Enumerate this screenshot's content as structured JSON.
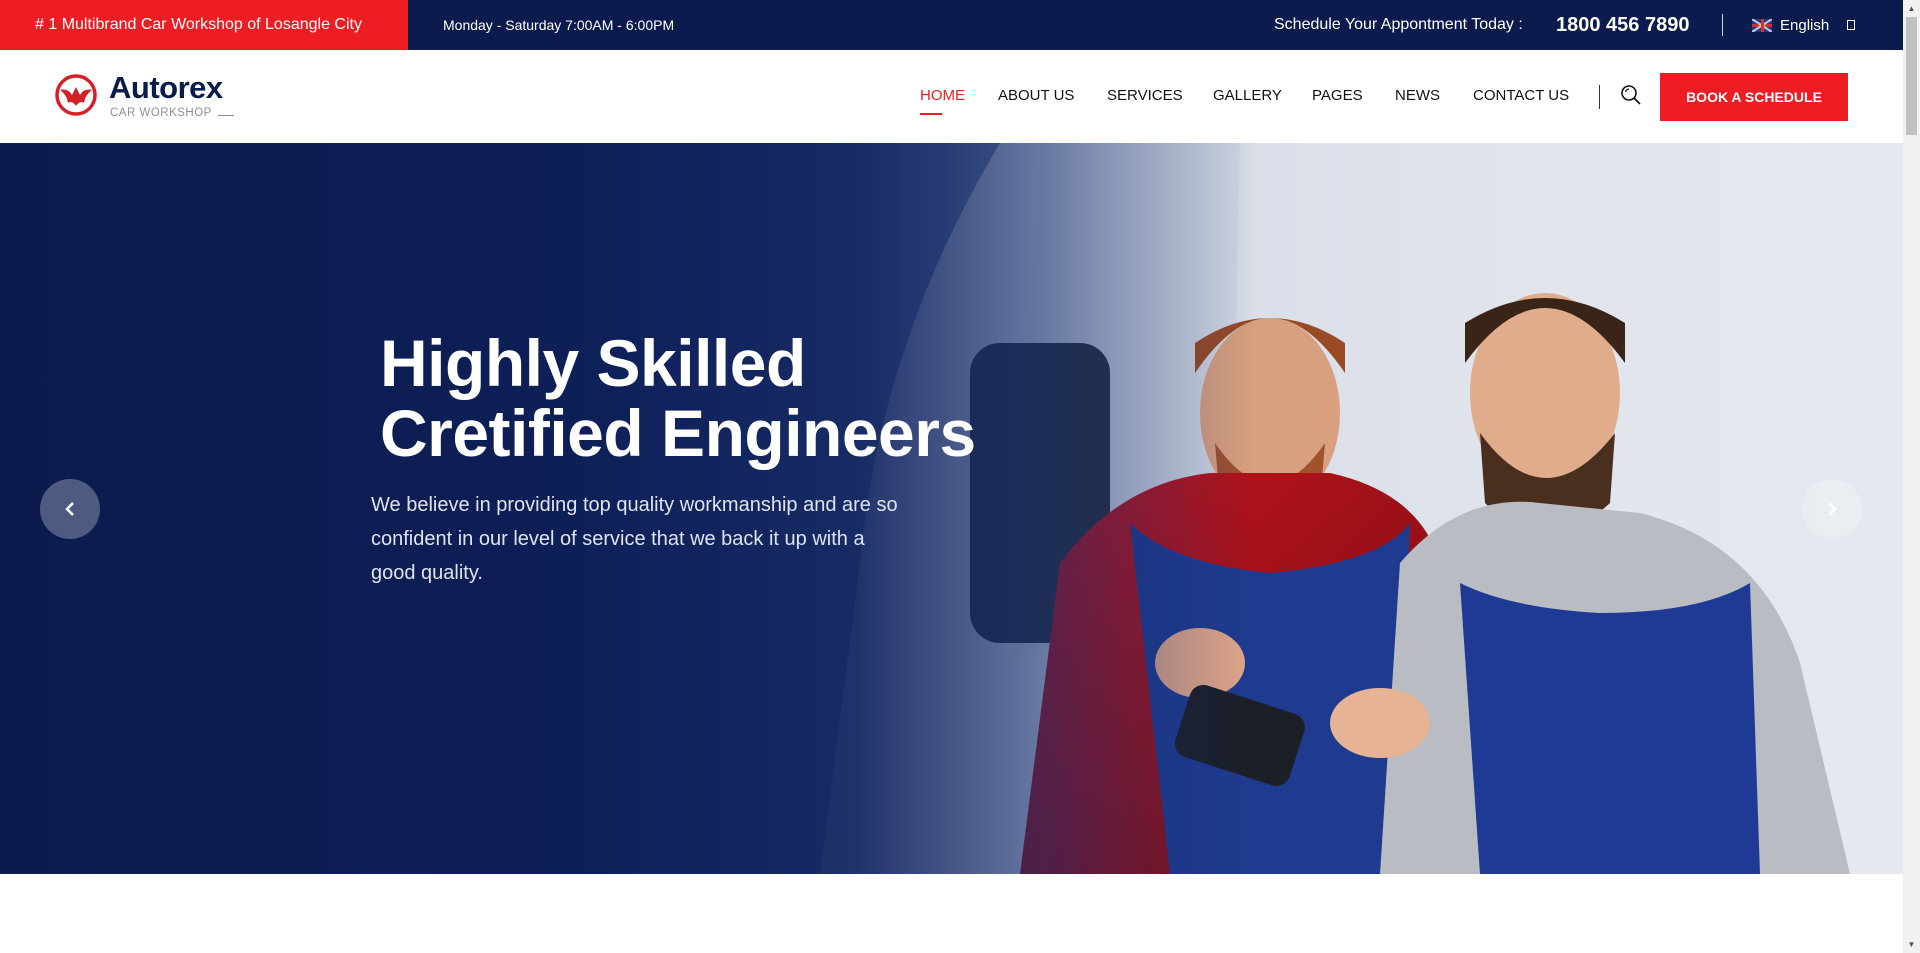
{
  "topbar": {
    "tagline": "# 1 Multibrand Car Workshop of Losangle City",
    "hours": "Monday - Saturday 7:00AM - 6:00PM",
    "schedule_label": "Schedule Your Appontment Today :",
    "phone": "1800 456 7890",
    "language": "English"
  },
  "logo": {
    "name": "Autorex",
    "subtitle": "CAR WORKSHOP"
  },
  "nav": {
    "items": [
      {
        "label": "HOME",
        "active": true
      },
      {
        "label": "ABOUT US"
      },
      {
        "label": "SERVICES"
      },
      {
        "label": "GALLERY"
      },
      {
        "label": "PAGES"
      },
      {
        "label": "NEWS"
      },
      {
        "label": "CONTACT US"
      }
    ],
    "book_label": "BOOK A SCHEDULE"
  },
  "hero": {
    "title_line1": "Highly Skilled",
    "title_line2": "Cretified Engineers",
    "text": "We believe in providing top quality workmanship and are so confident in our level of service that we back it up with a good quality."
  },
  "colors": {
    "brand_red": "#ee1d23",
    "navy": "#0c1b4d"
  },
  "icons": {
    "search": "search-icon",
    "prev": "chevron-left-icon",
    "next": "chevron-right-icon",
    "flag": "uk-flag-icon"
  }
}
